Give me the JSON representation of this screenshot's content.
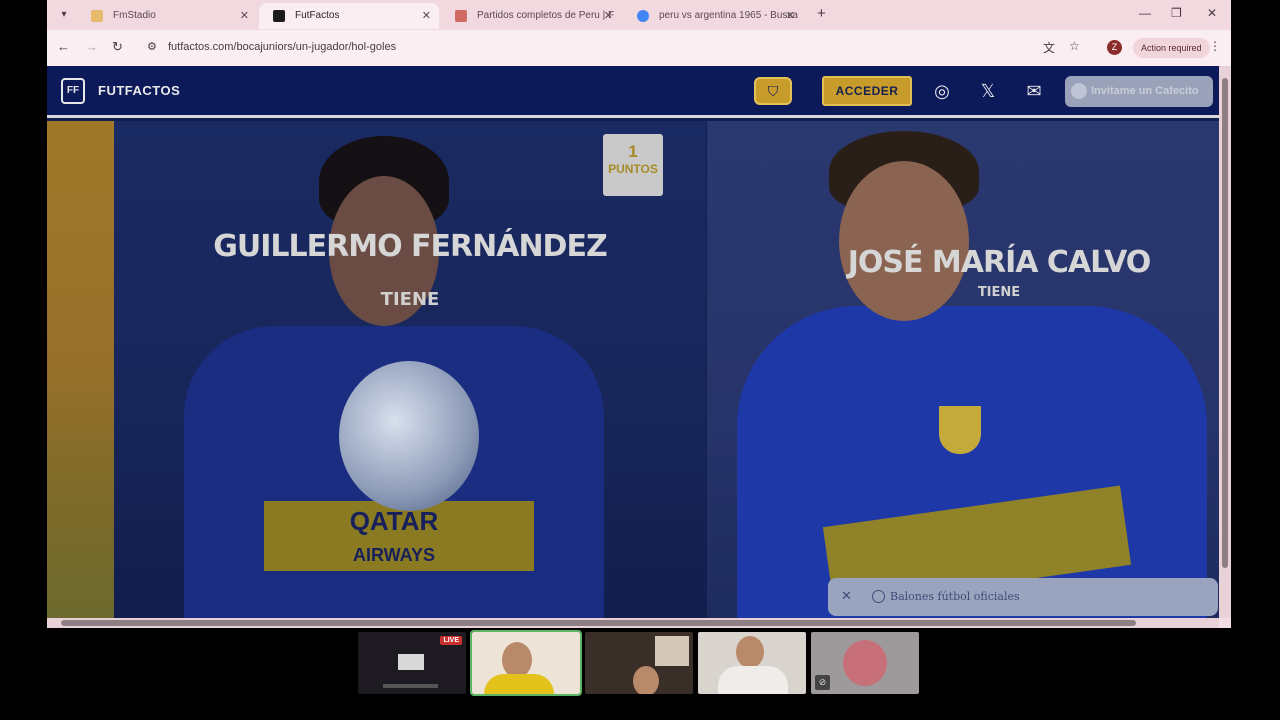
{
  "browser": {
    "tabs": [
      {
        "title": "FmStadio",
        "active": false,
        "favicon_color": "#e0a31c"
      },
      {
        "title": "FutFactos",
        "active": true,
        "favicon_color": "#1b1b1b"
      },
      {
        "title": "Partidos completos de Peru | F",
        "active": false,
        "favicon_color": "#c0392b"
      },
      {
        "title": "peru vs argentina 1965 - Busca",
        "active": false,
        "favicon_color": "#4285f4"
      }
    ],
    "url": "futfactos.com/bocajuniors/un-jugador/hol-goles",
    "profile_initial": "Z",
    "action_required": "Action required"
  },
  "site": {
    "brand": "FUTFACTOS",
    "acceder": "ACCEDER",
    "cafecito": "Invitame un Cafecito",
    "accent_gold": "#c89c2a",
    "navy": "#0d1a5a"
  },
  "game": {
    "left_player": {
      "name": "GUILLERMO FERNÁNDEZ",
      "tiene": "TIENE"
    },
    "right_player": {
      "name": "JOSÉ MARÍA CALVO",
      "tiene": "TIENE"
    },
    "points": {
      "value": "1",
      "label": "PUNTOS"
    }
  },
  "ad": {
    "text": "Balones fútbol oficiales"
  },
  "call": {
    "live_label": "LIVE"
  }
}
